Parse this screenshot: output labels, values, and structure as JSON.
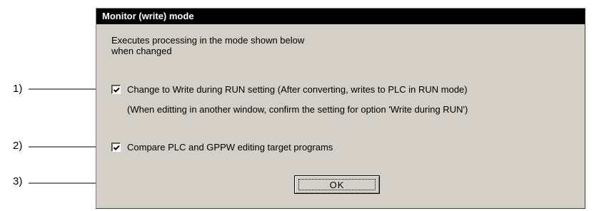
{
  "dialog": {
    "title": "Monitor (write) mode",
    "description_line1": "Executes processing in the mode shown below",
    "description_line2": "when changed",
    "option1": {
      "label": "Change to Write during RUN setting (After converting, writes to PLC in RUN mode)",
      "checked": true
    },
    "note": "(When editting in another window, confirm the setting for option 'Write during RUN')",
    "option2": {
      "label": "Compare PLC and GPPW editing target programs",
      "checked": true
    },
    "ok_label": "OK"
  },
  "callouts": [
    {
      "label": "1)"
    },
    {
      "label": "2)"
    },
    {
      "label": "3)"
    }
  ]
}
